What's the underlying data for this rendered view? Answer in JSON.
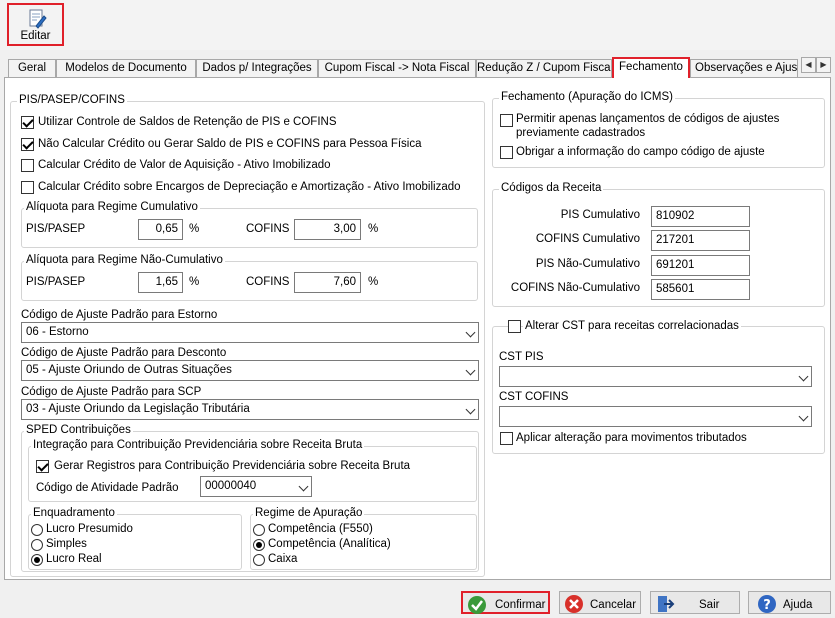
{
  "toolbar": {
    "edit_label": "Editar"
  },
  "tabs": [
    "Geral",
    "Modelos de Documento",
    "Dados p/ Integrações",
    "Cupom Fiscal -> Nota Fiscal",
    "Redução Z / Cupom Fiscal",
    "Fechamento",
    "Observações e Ajus"
  ],
  "active_tab": "Fechamento",
  "pis_cofins": {
    "title": "PIS/PASEP/COFINS",
    "options": [
      {
        "label": "Utilizar Controle de Saldos de Retenção de PIS e COFINS",
        "checked": true
      },
      {
        "label": "Não Calcular Crédito ou Gerar Saldo de PIS e COFINS para Pessoa Física",
        "checked": true
      },
      {
        "label": "Calcular Crédito de Valor de Aquisição - Ativo Imobilizado",
        "checked": false
      },
      {
        "label": "Calcular Crédito sobre Encargos de Depreciação e Amortização - Ativo Imobilizado",
        "checked": false
      }
    ],
    "cumulativo": {
      "title": "Alíquota para Regime Cumulativo",
      "pis_label": "PIS/PASEP",
      "pis_value": "0,65",
      "cofins_label": "COFINS",
      "cofins_value": "3,00",
      "unit": "%"
    },
    "nao_cumulativo": {
      "title": "Alíquota para Regime Não-Cumulativo",
      "pis_label": "PIS/PASEP",
      "pis_value": "1,65",
      "cofins_label": "COFINS",
      "cofins_value": "7,60",
      "unit": "%"
    },
    "estorno": {
      "label": "Código de Ajuste Padrão para Estorno",
      "value": "06 - Estorno"
    },
    "desconto": {
      "label": "Código de Ajuste Padrão para Desconto",
      "value": "05 - Ajuste Oriundo de Outras Situações"
    },
    "scp": {
      "label": "Código de Ajuste Padrão para SCP",
      "value": "03 - Ajuste Oriundo da Legislação Tributária"
    }
  },
  "sped": {
    "title": "SPED Contribuições",
    "integracao": {
      "title": "Integração para Contribuição Previdenciária sobre Receita Bruta",
      "gerar_label": "Gerar Registros para Contribuição Previdenciária sobre Receita Bruta",
      "gerar_checked": true,
      "atividade_label": "Código de Atividade Padrão",
      "atividade_value": "00000040"
    },
    "enquadramento": {
      "title": "Enquadramento",
      "options": [
        "Lucro Presumido",
        "Simples",
        "Lucro Real"
      ],
      "selected": "Lucro Real"
    },
    "regime": {
      "title": "Regime de Apuração",
      "options": [
        "Competência (F550)",
        "Competência (Analítica)",
        "Caixa"
      ],
      "selected": "Competência (Analítica)"
    }
  },
  "fechamento": {
    "title": "Fechamento (Apuração do ICMS)",
    "opt1_line1": "Permitir apenas lançamentos de códigos de ajustes",
    "opt1_line2": "previamente cadastrados",
    "opt1_checked": false,
    "opt2": "Obrigar a informação do campo código de ajuste",
    "opt2_checked": false
  },
  "codigos": {
    "title": "Códigos da Receita",
    "rows": [
      {
        "label": "PIS Cumulativo",
        "value": "810902"
      },
      {
        "label": "COFINS Cumulativo",
        "value": "217201"
      },
      {
        "label": "PIS Não-Cumulativo",
        "value": "691201"
      },
      {
        "label": "COFINS Não-Cumulativo",
        "value": "585601"
      }
    ]
  },
  "cst": {
    "alterar_label": "Alterar CST para receitas correlacionadas",
    "alterar_checked": false,
    "pis_label": "CST PIS",
    "pis_value": "",
    "cofins_label": "CST COFINS",
    "cofins_value": "",
    "aplicar_label": "Aplicar alteração para movimentos tributados",
    "aplicar_checked": false
  },
  "buttons": {
    "confirmar": "Confirmar",
    "cancelar": "Cancelar",
    "sair": "Sair",
    "ajuda": "Ajuda"
  }
}
